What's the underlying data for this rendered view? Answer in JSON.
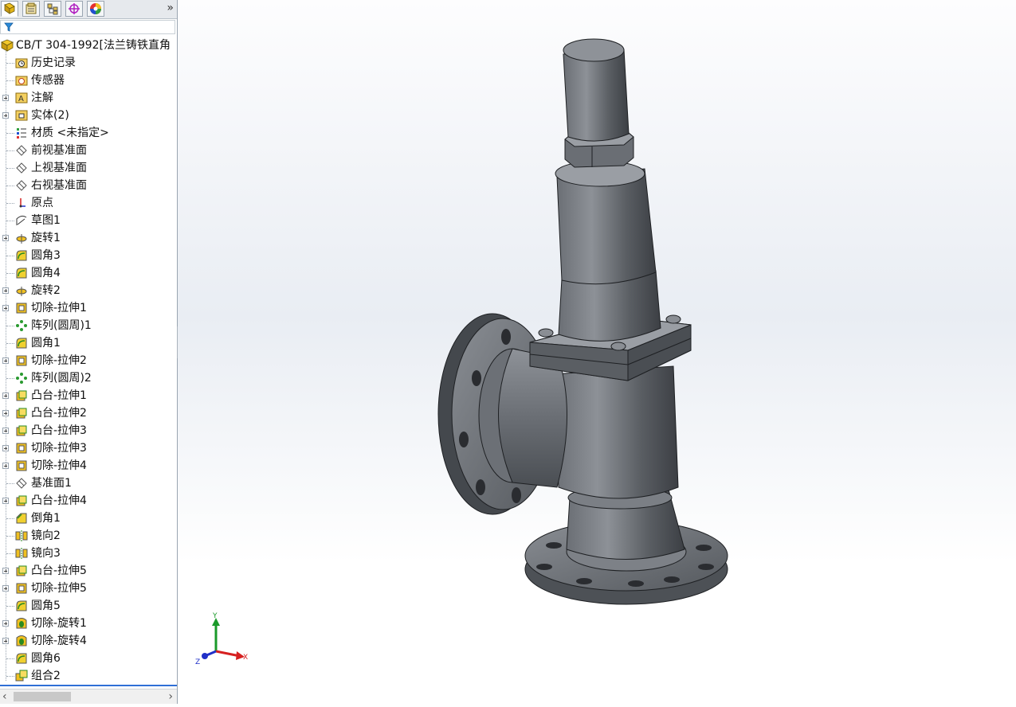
{
  "feature_manager": {
    "tabs": [
      {
        "icon": "feature-tree-icon",
        "active": true
      },
      {
        "icon": "property-manager-icon",
        "active": false
      },
      {
        "icon": "configuration-manager-icon",
        "active": false
      },
      {
        "icon": "dimxpert-icon",
        "active": false
      },
      {
        "icon": "display-manager-icon",
        "active": false
      }
    ],
    "more_label": "»",
    "filter_icon": "filter-icon",
    "root_label": "CB/T 304-1992[法兰铸铁直角",
    "items": [
      {
        "label": "历史记录",
        "icon": "history-folder-icon",
        "expandable": false
      },
      {
        "label": "传感器",
        "icon": "sensor-folder-icon",
        "expandable": false
      },
      {
        "label": "注解",
        "icon": "annotation-folder-icon",
        "expandable": true
      },
      {
        "label": "实体(2)",
        "icon": "solid-bodies-folder-icon",
        "expandable": true
      },
      {
        "label": "材质 <未指定>",
        "icon": "material-icon",
        "expandable": false
      },
      {
        "label": "前视基准面",
        "icon": "plane-icon",
        "expandable": false
      },
      {
        "label": "上视基准面",
        "icon": "plane-icon",
        "expandable": false
      },
      {
        "label": "右视基准面",
        "icon": "plane-icon",
        "expandable": false
      },
      {
        "label": "原点",
        "icon": "origin-icon",
        "expandable": false
      },
      {
        "label": "草图1",
        "icon": "sketch-icon",
        "expandable": false
      },
      {
        "label": "旋转1",
        "icon": "revolve-icon",
        "expandable": true
      },
      {
        "label": "圆角3",
        "icon": "fillet-icon",
        "expandable": false
      },
      {
        "label": "圆角4",
        "icon": "fillet-icon",
        "expandable": false
      },
      {
        "label": "旋转2",
        "icon": "revolve-icon",
        "expandable": true
      },
      {
        "label": "切除-拉伸1",
        "icon": "cut-extrude-icon",
        "expandable": true
      },
      {
        "label": "阵列(圆周)1",
        "icon": "circular-pattern-icon",
        "expandable": false
      },
      {
        "label": "圆角1",
        "icon": "fillet-icon",
        "expandable": false
      },
      {
        "label": "切除-拉伸2",
        "icon": "cut-extrude-icon",
        "expandable": true
      },
      {
        "label": "阵列(圆周)2",
        "icon": "circular-pattern-icon",
        "expandable": false
      },
      {
        "label": "凸台-拉伸1",
        "icon": "boss-extrude-icon",
        "expandable": true
      },
      {
        "label": "凸台-拉伸2",
        "icon": "boss-extrude-icon",
        "expandable": true
      },
      {
        "label": "凸台-拉伸3",
        "icon": "boss-extrude-icon",
        "expandable": true
      },
      {
        "label": "切除-拉伸3",
        "icon": "cut-extrude-icon",
        "expandable": true
      },
      {
        "label": "切除-拉伸4",
        "icon": "cut-extrude-icon",
        "expandable": true
      },
      {
        "label": "基准面1",
        "icon": "plane-icon",
        "expandable": false
      },
      {
        "label": "凸台-拉伸4",
        "icon": "boss-extrude-icon",
        "expandable": true
      },
      {
        "label": "倒角1",
        "icon": "chamfer-icon",
        "expandable": false
      },
      {
        "label": "镜向2",
        "icon": "mirror-icon",
        "expandable": false
      },
      {
        "label": "镜向3",
        "icon": "mirror-icon",
        "expandable": false
      },
      {
        "label": "凸台-拉伸5",
        "icon": "boss-extrude-icon",
        "expandable": true
      },
      {
        "label": "切除-拉伸5",
        "icon": "cut-extrude-icon",
        "expandable": true
      },
      {
        "label": "圆角5",
        "icon": "fillet-icon",
        "expandable": false
      },
      {
        "label": "切除-旋转1",
        "icon": "cut-revolve-icon",
        "expandable": true
      },
      {
        "label": "切除-旋转4",
        "icon": "cut-revolve-icon",
        "expandable": true
      },
      {
        "label": "圆角6",
        "icon": "fillet-icon",
        "expandable": false
      },
      {
        "label": "组合2",
        "icon": "combine-icon",
        "expandable": false
      }
    ]
  },
  "viewport": {
    "model": "angle-safety-valve-model",
    "triad": {
      "x_label": "X",
      "y_label": "Y",
      "z_label": "Z"
    }
  },
  "colors": {
    "model_dark": "#3c3f44",
    "model_mid": "#7a7e84",
    "model_light": "#c8cbcf",
    "accent_blue": "#2f6fd6",
    "axis_x": "#d62020",
    "axis_y": "#1a9a2a",
    "axis_z": "#2030c8"
  }
}
